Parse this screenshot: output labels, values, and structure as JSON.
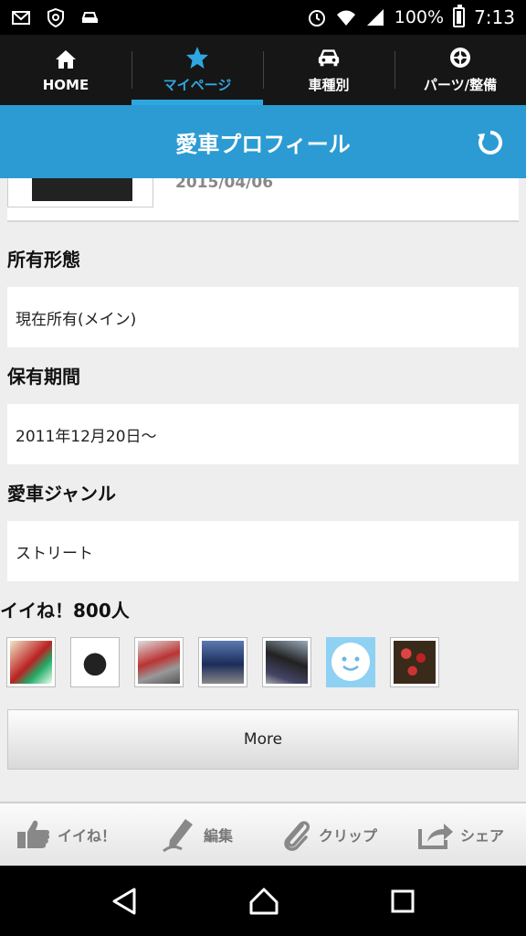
{
  "status_bar": {
    "battery": "100%",
    "time": "7:13"
  },
  "tabs": [
    {
      "label": "HOME",
      "icon": "home-icon"
    },
    {
      "label": "マイページ",
      "icon": "star-icon"
    },
    {
      "label": "車種別",
      "icon": "car-icon"
    },
    {
      "label": "パーツ/整備",
      "icon": "tire-icon"
    }
  ],
  "active_tab": "マイページ",
  "title_bar": {
    "title": "愛車プロフィール"
  },
  "profile": {
    "date": "2015/04/06",
    "ownership_title": "所有形態",
    "ownership_value": "現在所有(メイン)",
    "period_title": "保有期間",
    "period_value": "2011年12月20日～",
    "genre_title": "愛車ジャンル",
    "genre_value": "ストリート"
  },
  "likes": {
    "title": "イイね！800人",
    "avatar_count": 7,
    "more_label": "More"
  },
  "action_bar": [
    {
      "label": "イイね！",
      "icon": "thumbs-up-icon"
    },
    {
      "label": "編集",
      "icon": "pencil-icon"
    },
    {
      "label": "クリップ",
      "icon": "paperclip-icon"
    },
    {
      "label": "シェア",
      "icon": "share-icon"
    }
  ],
  "colors": {
    "accent": "#2c9bd3",
    "tab_bg": "#161616"
  }
}
